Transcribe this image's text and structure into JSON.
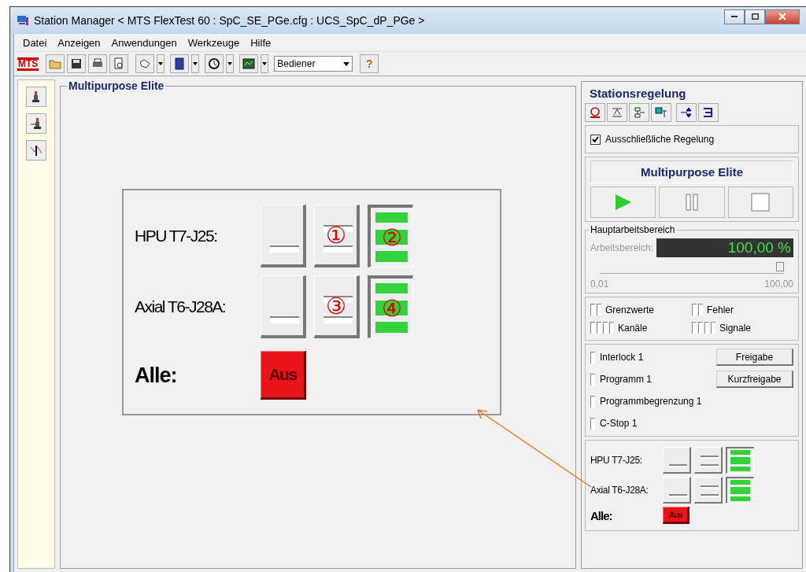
{
  "window": {
    "title": "Station Manager < MTS FlexTest 60 : SpC_SE_PGe.cfg : UCS_SpC_dP_PGe >"
  },
  "menu": [
    "Datei",
    "Anzeigen",
    "Anwendungen",
    "Werkzeuge",
    "Hilfe"
  ],
  "toolbar": {
    "logo": "MTS",
    "role": "Bediener",
    "help": "?"
  },
  "main": {
    "title": "Multipurpose Elite",
    "hpu_rows": [
      {
        "label": "HPU T7-J25:",
        "button_mark": "①",
        "lamp_mark": "②",
        "on": true
      },
      {
        "label": "Axial T6-J28A:",
        "button_mark": "③",
        "lamp_mark": "④",
        "on": true
      }
    ],
    "all_label": "Alle:",
    "off_button": "Aus"
  },
  "station": {
    "title": "Stationsregelung",
    "exclusive": {
      "label": "Ausschließliche Regelung",
      "checked": true
    },
    "name": "Multipurpose Elite",
    "range": {
      "title": "Hauptarbeitsbereich",
      "label": "Arbeitsbereich:",
      "reading": "100,00 %",
      "level": 1,
      "min": "0,01",
      "max": "100,00"
    },
    "indicators": [
      {
        "label": "Grenzwerte",
        "kind": "double"
      },
      {
        "label": "Fehler",
        "kind": "double"
      },
      {
        "label": "Kanäle",
        "kind": "quad"
      },
      {
        "label": "Signale",
        "kind": "quad"
      }
    ],
    "interlocks": [
      {
        "label": "Interlock 1",
        "button": "Freigabe"
      },
      {
        "label": "Programm 1",
        "button": "Kurzfreigabe"
      },
      {
        "label": "Programmbegrenzung 1"
      },
      {
        "label": "C-Stop 1"
      }
    ],
    "hpu_rows": [
      {
        "label": "HPU T7-J25:",
        "on": true
      },
      {
        "label": "Axial T6-J28A:",
        "on": true
      }
    ],
    "all_label": "Alle:",
    "off_button": "Aus"
  }
}
